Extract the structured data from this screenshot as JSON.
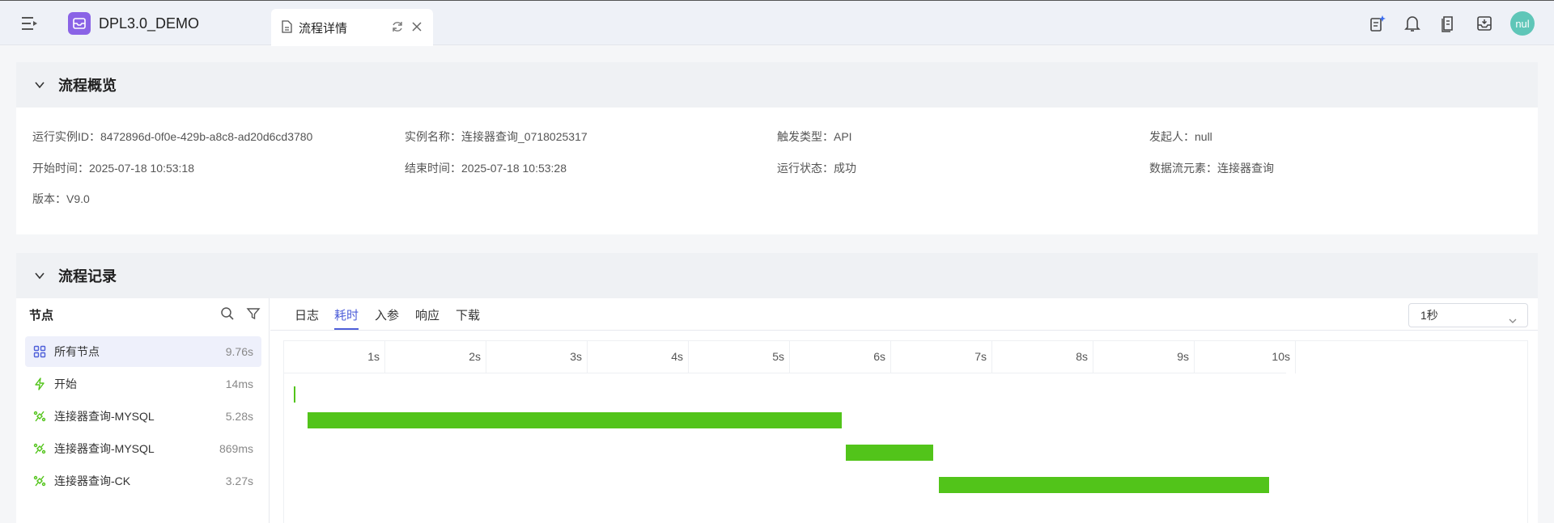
{
  "header": {
    "app_title": "DPL3.0_DEMO",
    "tab_label": "流程详情",
    "avatar_text": "nul",
    "icons": [
      "menu-fold-icon",
      "app-logo-icon",
      "document-icon",
      "refresh-icon",
      "close-icon",
      "ai-notes-icon",
      "bell-icon",
      "file-list-icon",
      "inbox-download-icon"
    ]
  },
  "overview": {
    "title": "流程概览",
    "run_id": "运行实例ID：8472896d-0f0e-429b-a8c8-ad20d6cd3780",
    "instance_name": "实例名称：连接器查询_0718025317",
    "trigger_type": "触发类型：API",
    "initiator": "发起人：null",
    "start_time": "开始时间：2025-07-18 10:53:18",
    "end_time": "结束时间：2025-07-18 10:53:28",
    "run_status": "运行状态：成功",
    "data_flow_element": "数据流元素：连接器查询",
    "version": "版本：V9.0"
  },
  "records": {
    "title": "流程记录",
    "nodes_header": "节点",
    "nodes": [
      {
        "name": "所有节点",
        "duration": "9.76s",
        "icon": "grid-icon"
      },
      {
        "name": "开始",
        "duration": "14ms",
        "icon": "lightning-icon"
      },
      {
        "name": "连接器查询-MYSQL",
        "duration": "5.28s",
        "icon": "connector-icon"
      },
      {
        "name": "连接器查询-MYSQL",
        "duration": "869ms",
        "icon": "connector-icon"
      },
      {
        "name": "连接器查询-CK",
        "duration": "3.27s",
        "icon": "connector-icon"
      }
    ],
    "tabs": [
      "日志",
      "耗时",
      "入参",
      "响应",
      "下载"
    ],
    "active_tab": "耗时",
    "scale_select": "1秒",
    "timeline": {
      "ticks": [
        "1s",
        "2s",
        "3s",
        "4s",
        "5s",
        "6s",
        "7s",
        "8s",
        "9s",
        "10s"
      ],
      "bar_color": "#52c41a",
      "spans": [
        {
          "node": "开始",
          "start_s": 0.05,
          "end_s": 0.064
        },
        {
          "node": "连接器查询-MYSQL",
          "start_s": 0.18,
          "end_s": 5.46
        },
        {
          "node": "连接器查询-MYSQL",
          "start_s": 5.5,
          "end_s": 6.37
        },
        {
          "node": "连接器查询-CK",
          "start_s": 6.42,
          "end_s": 9.69
        }
      ]
    }
  }
}
